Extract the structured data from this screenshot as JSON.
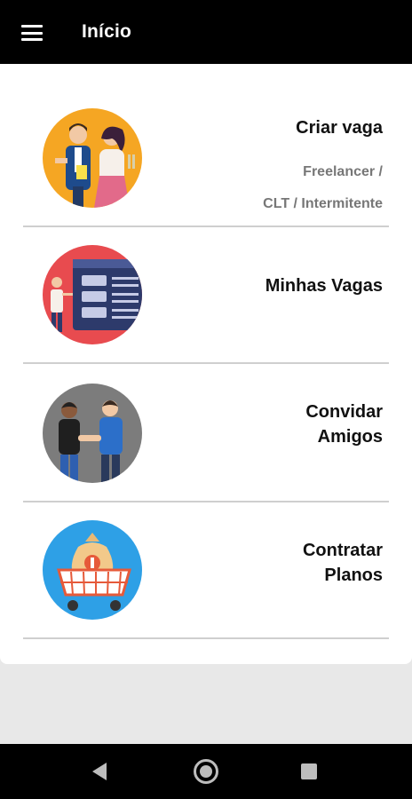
{
  "appbar": {
    "title": "Início",
    "menu_icon": "menu-icon"
  },
  "menu_items": [
    {
      "label": "Criar vaga",
      "sub_line1": "Freelancer /",
      "sub_line2": "CLT / Intermitente",
      "icon": "people-icon",
      "circle_color": "#f5a623"
    },
    {
      "label": "Minhas Vagas",
      "icon": "job-board-icon",
      "circle_color": "#e84b4f"
    },
    {
      "label_line1": "Convidar",
      "label_line2": "Amigos",
      "icon": "handshake-icon",
      "circle_color": "#7c7c7c"
    },
    {
      "label_line1": "Contratar",
      "label_line2": "Planos",
      "icon": "shopping-cart-money-icon",
      "circle_color": "#2ea0e6"
    }
  ],
  "system_nav": {
    "back_icon": "back-icon",
    "home_icon": "home-icon",
    "recents_icon": "recents-icon"
  }
}
